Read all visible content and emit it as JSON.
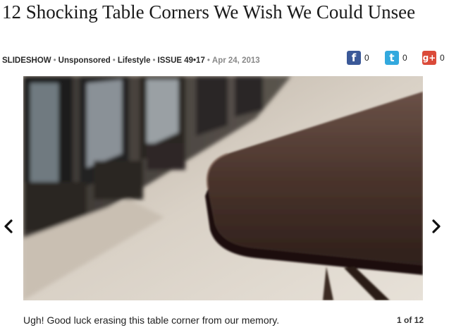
{
  "article": {
    "title": "12 Shocking Table Corners We Wish We Could Unsee",
    "meta": {
      "type": "SLIDESHOW",
      "sponsorship": "Unsponsored",
      "section": "Lifestyle",
      "issue": "ISSUE 49•17",
      "date": "Apr 24, 2013",
      "separator": "•"
    }
  },
  "share": {
    "facebook": {
      "icon": "facebook-icon",
      "glyph": "f",
      "count": "0",
      "color": "#3b5998"
    },
    "twitter": {
      "icon": "twitter-icon",
      "glyph": "t",
      "count": "0",
      "color": "#33a9de"
    },
    "googleplus": {
      "icon": "google-plus-icon",
      "glyph": "g+",
      "count": "0",
      "color": "#db4a39"
    }
  },
  "slideshow": {
    "caption": "Ugh! Good luck erasing this table corner from our memory.",
    "counter": "1 of 12",
    "prev_icon": "chevron-left-icon",
    "next_icon": "chevron-right-icon"
  }
}
